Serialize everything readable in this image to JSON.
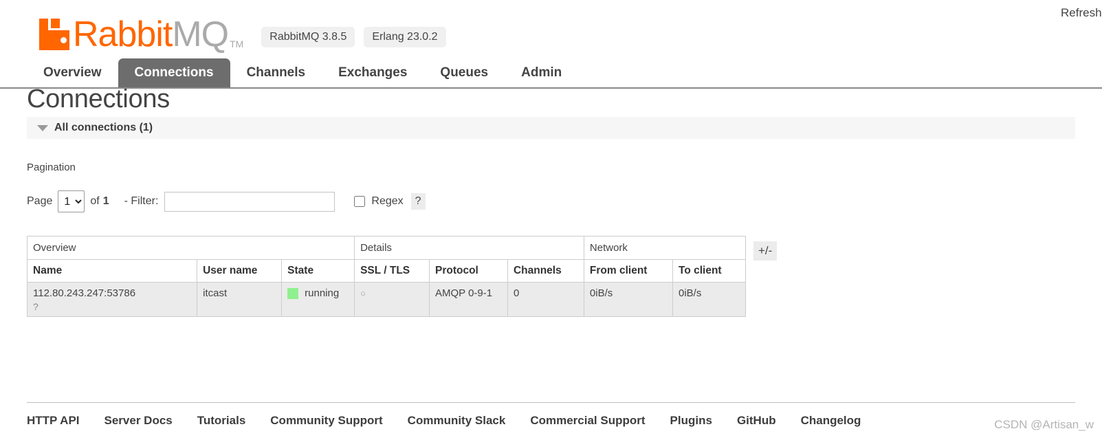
{
  "header": {
    "logo_rabbit": "Rabbit",
    "logo_mq": "MQ",
    "logo_tm": "TM",
    "badges": [
      {
        "label": "RabbitMQ 3.8.5"
      },
      {
        "label": "Erlang 23.0.2"
      }
    ],
    "refresh_label": "Refresh"
  },
  "tabs": [
    {
      "label": "Overview",
      "active": false
    },
    {
      "label": "Connections",
      "active": true
    },
    {
      "label": "Channels",
      "active": false
    },
    {
      "label": "Exchanges",
      "active": false
    },
    {
      "label": "Queues",
      "active": false
    },
    {
      "label": "Admin",
      "active": false
    }
  ],
  "page": {
    "title": "Connections",
    "section_label": "All connections (1)"
  },
  "pagination": {
    "heading": "Pagination",
    "page_label": "Page",
    "page_value": "1",
    "page_options": [
      "1"
    ],
    "of_label": "of",
    "total_pages": "1",
    "filter_label": "- Filter:",
    "filter_value": "",
    "filter_placeholder": "",
    "regex_label": "Regex",
    "regex_checked": false,
    "help_label": "?"
  },
  "table": {
    "groups": [
      {
        "label": "Overview",
        "span": 3
      },
      {
        "label": "Details",
        "span": 3
      },
      {
        "label": "Network",
        "span": 2
      }
    ],
    "columns": [
      "Name",
      "User name",
      "State",
      "SSL / TLS",
      "Protocol",
      "Channels",
      "From client",
      "To client"
    ],
    "rows": [
      {
        "name": "112.80.243.247:53786",
        "name_help": "?",
        "user_name": "itcast",
        "state": "running",
        "state_color": "#8ff08f",
        "ssl_tls": "○",
        "protocol": "AMQP 0-9-1",
        "channels": "0",
        "from_client": "0iB/s",
        "to_client": "0iB/s"
      }
    ],
    "toggle_columns_label": "+/-"
  },
  "footer": {
    "links": [
      "HTTP API",
      "Server Docs",
      "Tutorials",
      "Community Support",
      "Community Slack",
      "Commercial Support",
      "Plugins",
      "GitHub",
      "Changelog"
    ]
  },
  "watermark": "CSDN @Artisan_w"
}
